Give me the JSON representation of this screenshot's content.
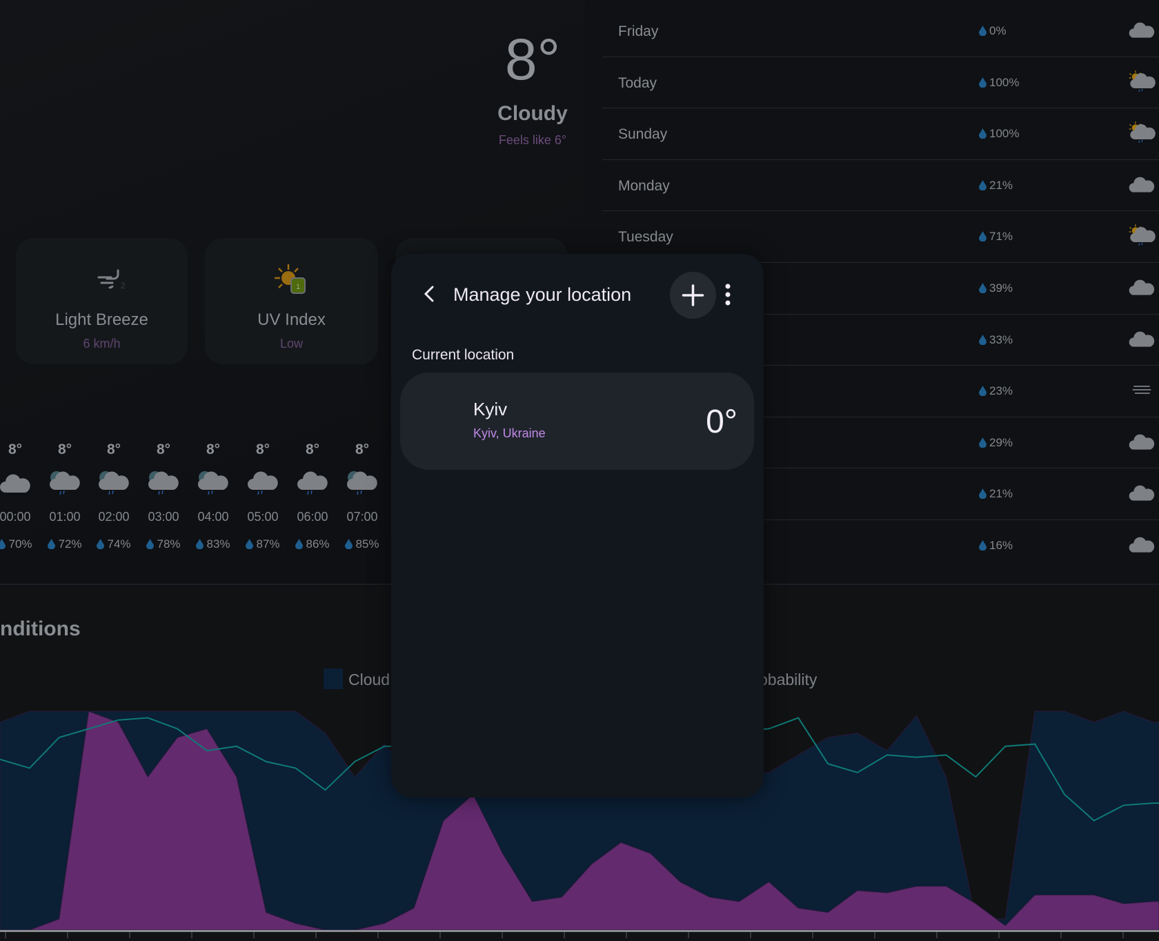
{
  "current": {
    "temp": "8°",
    "condition": "Cloudy",
    "feels_like": "Feels like 6°"
  },
  "cards": [
    {
      "label": "Light Breeze",
      "value": "6 km/h",
      "icon": "wind-icon"
    },
    {
      "label": "UV Index",
      "value": "Low",
      "icon": "uv-index-icon",
      "badge": "1"
    }
  ],
  "hourly": [
    {
      "temp": "8°",
      "time": "00:00",
      "precip": "70%",
      "icon": "cloud"
    },
    {
      "temp": "8°",
      "time": "01:00",
      "precip": "72%",
      "icon": "moon-cloud-rain"
    },
    {
      "temp": "8°",
      "time": "02:00",
      "precip": "74%",
      "icon": "moon-cloud-rain"
    },
    {
      "temp": "8°",
      "time": "03:00",
      "precip": "78%",
      "icon": "moon-cloud-rain"
    },
    {
      "temp": "8°",
      "time": "04:00",
      "precip": "83%",
      "icon": "moon-cloud-rain"
    },
    {
      "temp": "8°",
      "time": "05:00",
      "precip": "87%",
      "icon": "cloud-rain"
    },
    {
      "temp": "8°",
      "time": "06:00",
      "precip": "86%",
      "icon": "cloud-rain"
    },
    {
      "temp": "8°",
      "time": "07:00",
      "precip": "85%",
      "icon": "moon-cloud-rain"
    }
  ],
  "daily": [
    {
      "day": "Friday",
      "precip": "0%",
      "icon": "cloud"
    },
    {
      "day": "Today",
      "precip": "100%",
      "icon": "sun-cloud-rain"
    },
    {
      "day": "Sunday",
      "precip": "100%",
      "icon": "sun-cloud-rain"
    },
    {
      "day": "Monday",
      "precip": "21%",
      "icon": "cloud"
    },
    {
      "day": "Tuesday",
      "precip": "71%",
      "icon": "sun-cloud-rain"
    },
    {
      "day": "",
      "precip": "39%",
      "icon": "cloud"
    },
    {
      "day": "",
      "precip": "33%",
      "icon": "cloud"
    },
    {
      "day": "",
      "precip": "23%",
      "icon": "fog"
    },
    {
      "day": "",
      "precip": "29%",
      "icon": "cloud"
    },
    {
      "day": "",
      "precip": "21%",
      "icon": "cloud"
    },
    {
      "day": "",
      "precip": "16%",
      "icon": "cloud"
    }
  ],
  "conditions": {
    "heading": "nditions",
    "legend": [
      "Cloud",
      "obability"
    ]
  },
  "chart_data": {
    "type": "area",
    "ylim": [
      0,
      100
    ],
    "grid": false,
    "legend_placement": "top",
    "series": [
      {
        "name": "Cloud",
        "color": "#0b1f35",
        "values": [
          95,
          100,
          100,
          100,
          100,
          100,
          100,
          100,
          100,
          100,
          100,
          90,
          70,
          85,
          70,
          68,
          68,
          68,
          68,
          68,
          68,
          68,
          68,
          68,
          68,
          70,
          72,
          80,
          88,
          90,
          82,
          98,
          70,
          5,
          5,
          100,
          100,
          95,
          100,
          95
        ]
      },
      {
        "color": "#632a6e",
        "values": [
          0,
          0,
          5,
          100,
          95,
          70,
          88,
          92,
          70,
          8,
          3,
          0,
          0,
          3,
          10,
          50,
          62,
          35,
          13,
          15,
          30,
          40,
          35,
          22,
          15,
          13,
          22,
          10,
          8,
          18,
          17,
          20,
          20,
          12,
          2,
          16,
          16,
          16,
          12,
          13
        ]
      },
      {
        "color": "#0f7a77",
        "type": "line",
        "values": [
          78,
          74,
          88,
          92,
          96,
          97,
          92,
          82,
          84,
          77,
          74,
          64,
          77,
          84,
          84,
          82,
          80,
          80,
          82,
          84,
          85,
          86,
          88,
          88,
          90,
          91,
          92,
          97,
          76,
          72,
          80,
          79,
          80,
          70,
          84,
          85,
          62,
          50,
          57,
          58
        ]
      }
    ]
  },
  "modal": {
    "title": "Manage your location",
    "section": "Current location",
    "location": {
      "name": "Kyiv",
      "region": "Kyiv, Ukraine",
      "temp": "0°"
    }
  },
  "colors": {
    "accent": "#c08ae6",
    "modal_bg": "#12171e",
    "card_bg": "#1f242b"
  }
}
